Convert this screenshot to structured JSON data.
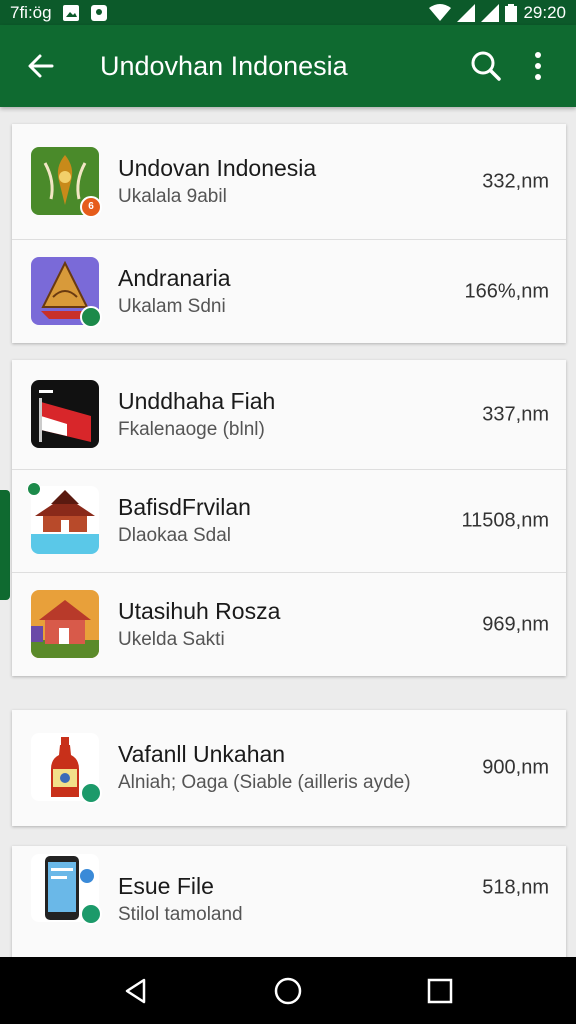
{
  "status_bar": {
    "time_left": "7fi:ög",
    "time_right": "29:20"
  },
  "app_bar": {
    "title": "Undovhan Indonesia",
    "back_icon": "arrow-back-icon",
    "search_icon": "search-icon",
    "more_icon": "more-vert-icon"
  },
  "groups": [
    {
      "items": [
        {
          "name": "Undovan Indonesia",
          "subtitle": "Ukalala 9abil",
          "size": "332,nm",
          "icon": "folk-art-icon",
          "badge_color": "#e65c1b",
          "badge_text": "6"
        },
        {
          "name": "Andranaria",
          "subtitle": "Ukalam Sdni",
          "size": "166%,nm",
          "icon": "wayang-icon",
          "badge_color": "#1c8a4a",
          "badge_text": ""
        }
      ]
    },
    {
      "items": [
        {
          "name": "Unddhaha Fiah",
          "subtitle": "Fkalenaoge (blnl)",
          "size": "337,nm",
          "icon": "flag-icon",
          "badge_color": "",
          "badge_text": ""
        },
        {
          "name": "BafisdFrvilan",
          "subtitle": "Dlaokaa Sdal",
          "size": "11508,nm",
          "icon": "traditional-house-icon",
          "badge_color": "#1c8a4a",
          "badge_text": ""
        },
        {
          "name": "Utasihuh Rosza",
          "subtitle": "Ukelda Sakti",
          "size": "969,nm",
          "icon": "village-house-icon",
          "badge_color": "",
          "badge_text": ""
        }
      ]
    },
    {
      "items": [
        {
          "name": "Vafanll Unkahan",
          "subtitle": "Alniah; Oaga (Siable (ailleris ayde)",
          "size": "900,nm",
          "icon": "bottle-icon",
          "badge_color": "#1c9a6a",
          "badge_text": ""
        }
      ]
    },
    {
      "items": [
        {
          "name": "Esue File",
          "subtitle": "Stilol tamoland",
          "size": "518,nm",
          "icon": "phone-file-icon",
          "badge_color": "#1c9a6a",
          "badge_text": ""
        }
      ]
    }
  ],
  "nav_bar": {
    "back": "nav-back-icon",
    "home": "nav-home-icon",
    "recents": "nav-recents-icon"
  }
}
